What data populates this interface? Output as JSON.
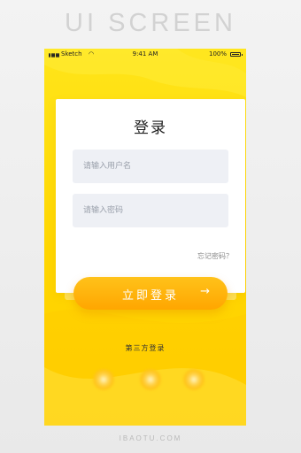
{
  "brand": "UI SCREEN",
  "status_bar": {
    "carrier": "Sketch",
    "time": "9:41 AM",
    "battery": "100%"
  },
  "login": {
    "title": "登录",
    "username_placeholder": "请输入用户名",
    "password_placeholder": "请输入密码",
    "forgot_link": "忘记密码？",
    "submit_label": "立即登录",
    "submit_arrow": "→"
  },
  "third_party": {
    "heading": "第三方登录"
  },
  "footer": "IBAOTU.COM",
  "colors": {
    "background_top": "#ffe51a",
    "background_bottom": "#ffd000",
    "button": "#ffa600",
    "input_bg": "#eef0f5"
  }
}
